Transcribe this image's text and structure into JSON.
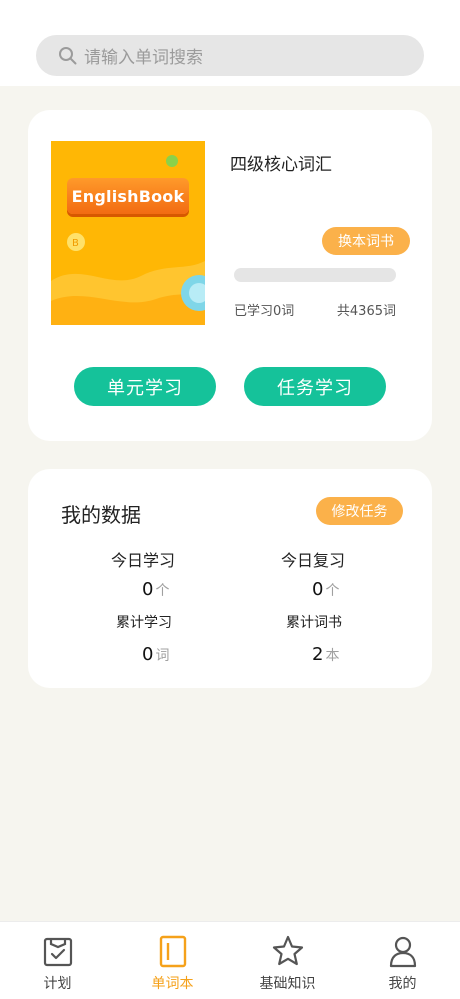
{
  "search": {
    "placeholder": "请输入单词搜索"
  },
  "book": {
    "cover_title": "EnglishBook",
    "name": "四级核心词汇",
    "change_label": "换本词书",
    "progress": 0,
    "learned_text": "已学习0词",
    "total_text": "共4365词",
    "unit_study_label": "单元学习",
    "task_study_label": "任务学习"
  },
  "data": {
    "title": "我的数据",
    "edit_label": "修改任务",
    "stats": [
      {
        "label": "今日学习",
        "value": "0",
        "unit": "个"
      },
      {
        "label": "今日复习",
        "value": "0",
        "unit": "个"
      },
      {
        "label": "累计学习",
        "value": "0",
        "unit": "词"
      },
      {
        "label": "累计词书",
        "value": "2",
        "unit": "本"
      }
    ]
  },
  "nav": {
    "items": [
      {
        "label": "计划",
        "icon": "plan-icon"
      },
      {
        "label": "单词本",
        "icon": "wordbook-icon"
      },
      {
        "label": "基础知识",
        "icon": "star-icon"
      },
      {
        "label": "我的",
        "icon": "user-icon"
      }
    ],
    "active_index": 1
  },
  "colors": {
    "accent_green": "#15c29a",
    "accent_orange": "#fbb14a",
    "active_nav": "#f5a11a"
  }
}
